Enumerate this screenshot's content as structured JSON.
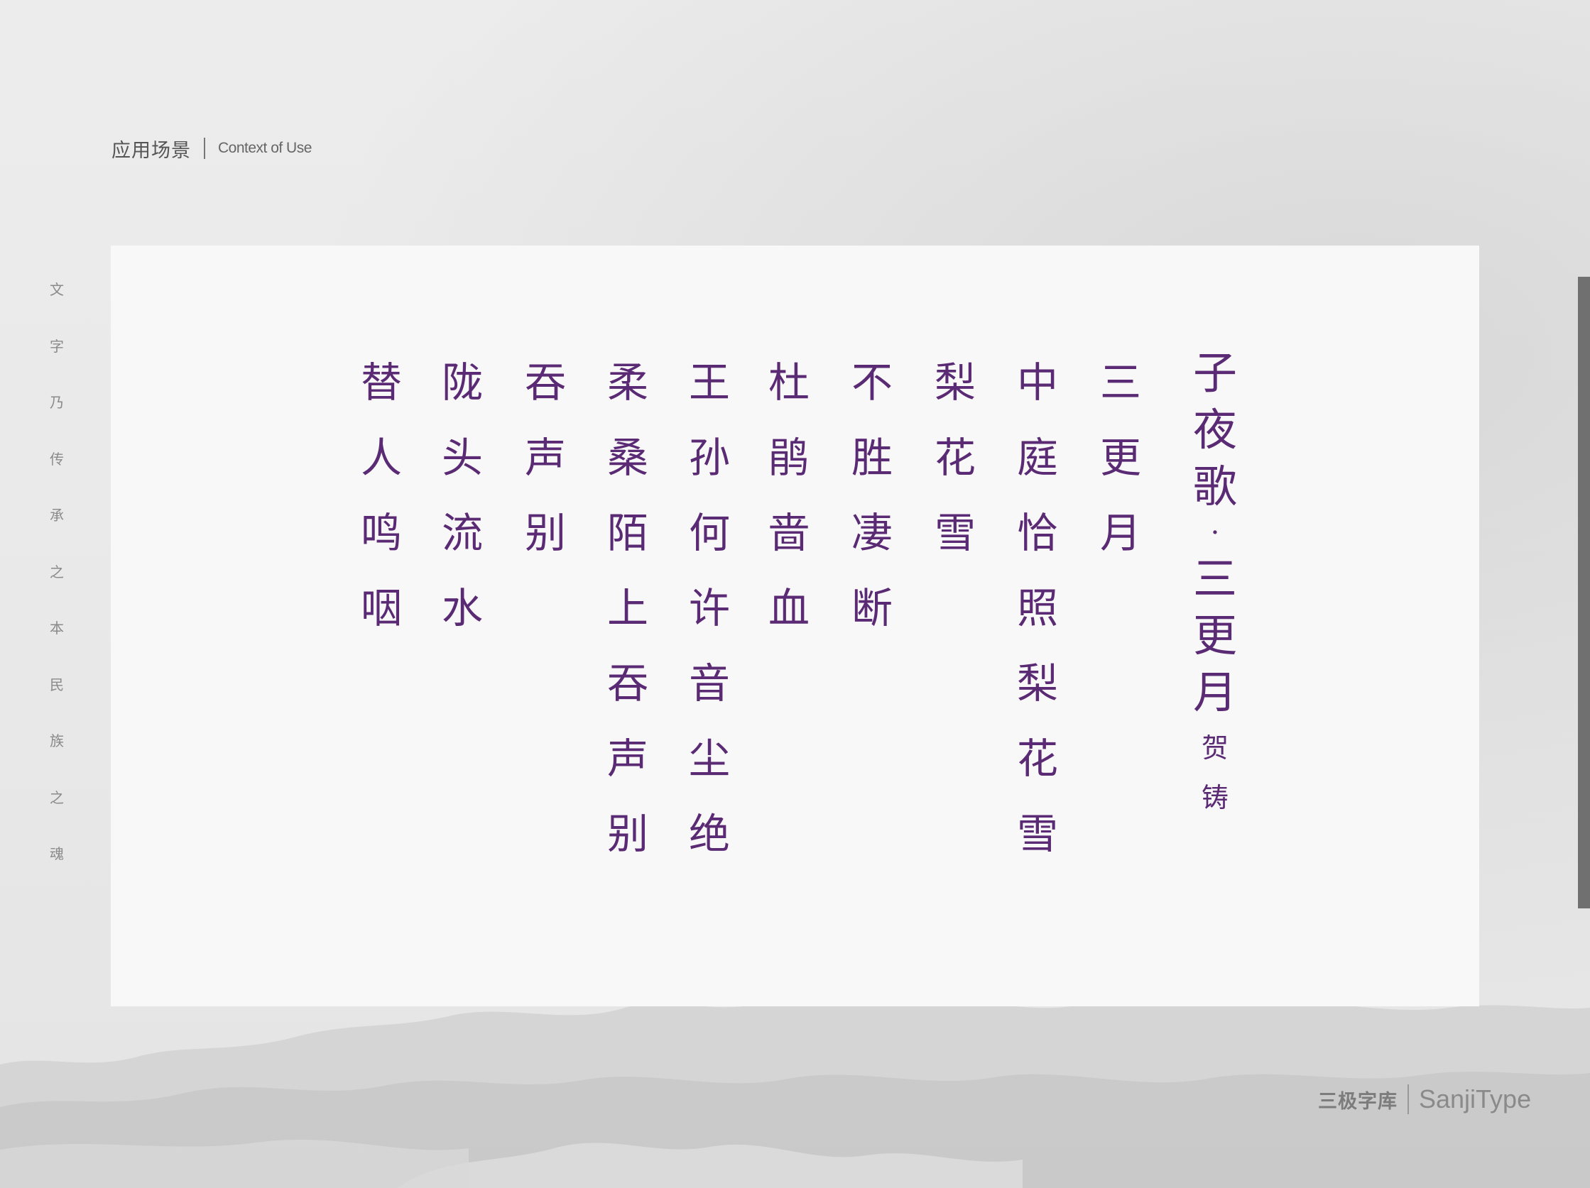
{
  "header": {
    "title_zh": "应用场景",
    "title_en": "Context of Use"
  },
  "side_slogan": [
    "文",
    "字",
    "乃",
    "传",
    "承",
    "之",
    "本",
    "民",
    "族",
    "之",
    "魂"
  ],
  "poem": {
    "title_part1": [
      "子",
      "夜",
      "歌"
    ],
    "title_dot": "·",
    "title_part2": [
      "三",
      "更",
      "月"
    ],
    "author": [
      "贺",
      "铸"
    ],
    "columns": [
      [
        "三",
        "更",
        "月"
      ],
      [
        "中",
        "庭",
        "恰",
        "照",
        "梨",
        "花",
        "雪"
      ],
      [
        "梨",
        "花",
        "雪"
      ],
      [
        "不",
        "胜",
        "凄",
        "断"
      ],
      [
        "杜",
        "鹃",
        "啬",
        "血"
      ],
      [
        "王",
        "孙",
        "何",
        "许",
        "音",
        "尘",
        "绝"
      ],
      [
        "柔",
        "桑",
        "陌",
        "上",
        "吞",
        "声",
        "别"
      ],
      [
        "吞",
        "声",
        "别"
      ],
      [
        "陇",
        "头",
        "流",
        "水"
      ],
      [
        "替",
        "人",
        "鸣",
        "咽"
      ]
    ]
  },
  "brand": {
    "name_zh": "三极字库",
    "name_en": "SanjiType"
  },
  "colors": {
    "poem_ink": "#5b2a74",
    "background": "#eaeaea",
    "card": "#f8f8f8"
  }
}
